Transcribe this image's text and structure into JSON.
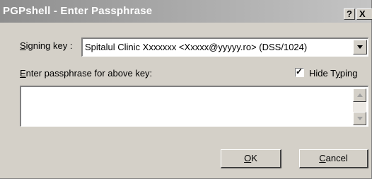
{
  "window": {
    "title": "PGPshell - Enter Passphrase",
    "help_button": "?",
    "close_button": "X"
  },
  "signing_key": {
    "label_mnemonic": "S",
    "label_rest": "igning key :",
    "selected_value": "Spitalul Clinic Xxxxxxx <Xxxxx@yyyyy.ro>   (DSS/1024)"
  },
  "passphrase": {
    "label_mnemonic": "E",
    "label_rest": "nter passphrase for above key:",
    "value": ""
  },
  "hide_typing": {
    "label_pre": "Hide T",
    "label_mnemonic": "y",
    "label_post": "ping",
    "checked": true
  },
  "buttons": {
    "ok_mnemonic": "O",
    "ok_rest": "K",
    "cancel_mnemonic": "C",
    "cancel_rest": "ancel"
  }
}
